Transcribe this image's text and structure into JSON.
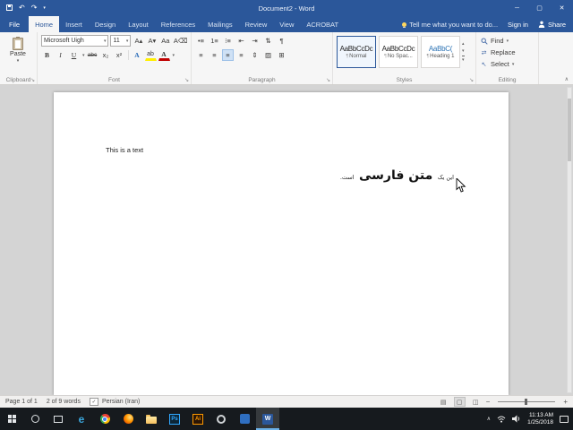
{
  "colors": {
    "accent": "#2b579a",
    "heading": "#2e74b5",
    "taskbar_active_underline": "#6cb2e8"
  },
  "titlebar": {
    "title": "Document2 - Word"
  },
  "window_controls": {
    "minimize": "─",
    "maximize": "▢",
    "close": "✕"
  },
  "qat": {
    "undo": "↶",
    "redo": "↷",
    "dropdown": "▾"
  },
  "tabs": {
    "file": "File",
    "items": [
      "Home",
      "Insert",
      "Design",
      "Layout",
      "References",
      "Mailings",
      "Review",
      "View",
      "ACROBAT"
    ],
    "tell_me": "Tell me what you want to do...",
    "sign_in": "Sign in",
    "share": "Share"
  },
  "ribbon": {
    "collapse": "∧",
    "clipboard": {
      "paste": "Paste",
      "dropdown": "▾",
      "label": "Clipboard"
    },
    "font": {
      "name": "Microsoft Uigh",
      "size": "11",
      "grow": "A▴",
      "shrink": "A▾",
      "change_case": "Aa",
      "clear": "A⌫",
      "bold": "B",
      "italic": "I",
      "underline": "U",
      "strike": "abc",
      "subscript": "x₂",
      "superscript": "x²",
      "effects": "A",
      "highlight": "ab",
      "color": "A",
      "dropdown": "▾",
      "label": "Font"
    },
    "paragraph": {
      "bullets": "•≡",
      "numbering": "1≡",
      "multilevel": "⁝≡",
      "outdent": "⇤",
      "indent": "⇥",
      "sort": "⇅",
      "pilcrow": "¶",
      "align_left": "≡",
      "align_center": "≡",
      "align_right": "≡",
      "justify": "≡",
      "spacing": "⇕",
      "shading": "▨",
      "borders": "⊞",
      "label": "Paragraph"
    },
    "styles": {
      "label": "Styles",
      "up": "▴",
      "down": "▾",
      "more": "▾",
      "items": [
        {
          "preview": "AaBbCcDc",
          "pilcrow": "¶",
          "name": "Normal"
        },
        {
          "preview": "AaBbCcDc",
          "pilcrow": "¶",
          "name": "No Spac..."
        },
        {
          "preview": "AaBbC(",
          "pilcrow": "¶",
          "name": "Heading 1"
        }
      ]
    },
    "editing": {
      "find": "Find",
      "replace": "Replace",
      "select": "Select",
      "replace_icon": "⇄",
      "select_icon": "↖",
      "dropdown": "▾",
      "label": "Editing"
    }
  },
  "document": {
    "ltr_text": "This is a text",
    "rtl_before": "این یک",
    "rtl_main": "متن فارسی",
    "rtl_after": "است."
  },
  "statusbar": {
    "page": "Page 1 of 1",
    "words": "2 of 9 words",
    "proof": "✓",
    "language": "Persian (Iran)",
    "view_read": "▤",
    "view_print": "▢",
    "view_web": "◫",
    "zoom_out": "−",
    "zoom_in": "+"
  },
  "taskbar": {
    "edge": "e",
    "ps": "Ps",
    "ai": "Ai",
    "word": "W",
    "tray_chevron": "∧",
    "time": "11:13 AM",
    "date": "1/25/2018"
  }
}
